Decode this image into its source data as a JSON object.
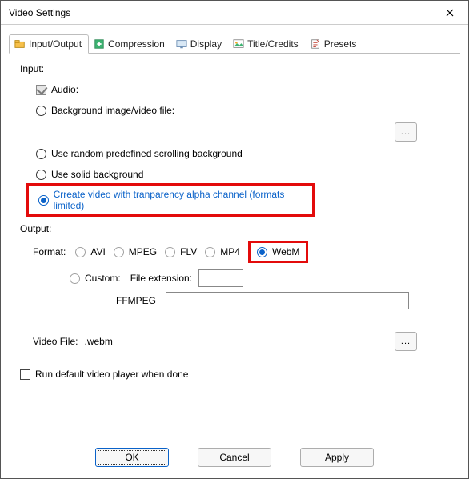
{
  "title": "Video Settings",
  "tabs": {
    "input_output": "Input/Output",
    "compression": "Compression",
    "display": "Display",
    "title_credits": "Title/Credits",
    "presets": "Presets"
  },
  "input": {
    "label": "Input:",
    "audio": "Audio:",
    "bg_file": "Background image/video file:",
    "random_bg": "Use random predefined scrolling background",
    "solid_bg": "Use solid background",
    "alpha": "Crreate video with tranparency alpha channel (formats limited)"
  },
  "output": {
    "label": "Output:",
    "format_label": "Format:",
    "avi": "AVI",
    "mpeg": "MPEG",
    "flv": "FLV",
    "mp4": "MP4",
    "webm": "WebM",
    "custom": "Custom:",
    "file_extension": "File extension:",
    "ffmpeg": "FFMPEG",
    "video_file_label": "Video File:",
    "video_file_value": ".webm",
    "run_player": "Run default video player when done"
  },
  "buttons": {
    "ok": "OK",
    "cancel": "Cancel",
    "apply": "Apply",
    "browse": "..."
  }
}
